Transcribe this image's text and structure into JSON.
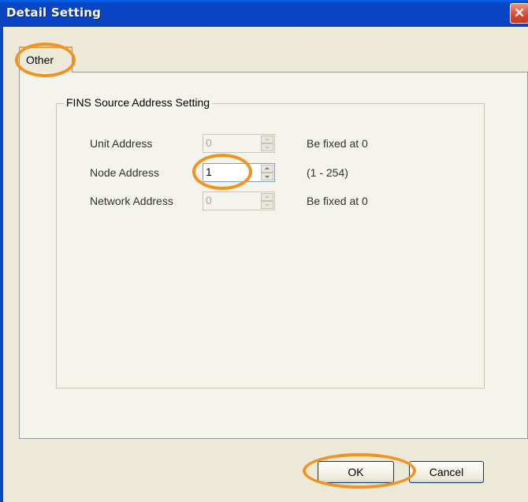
{
  "window": {
    "title": "Detail Setting",
    "close_symbol": "✕"
  },
  "tabs": [
    {
      "label": "Other"
    }
  ],
  "group": {
    "label": "FINS Source Address Setting",
    "fields": [
      {
        "label": "Unit Address",
        "value": "0",
        "note": "Be fixed at 0",
        "enabled": false
      },
      {
        "label": "Node Address",
        "value": "1",
        "note": "(1 - 254)",
        "enabled": true
      },
      {
        "label": "Network Address",
        "value": "0",
        "note": "Be fixed at 0",
        "enabled": false
      }
    ]
  },
  "buttons": {
    "ok": "OK",
    "cancel": "Cancel"
  },
  "colors": {
    "titlebar": "#0848c6",
    "highlight": "#f09421",
    "panel": "#f5f4ec"
  }
}
